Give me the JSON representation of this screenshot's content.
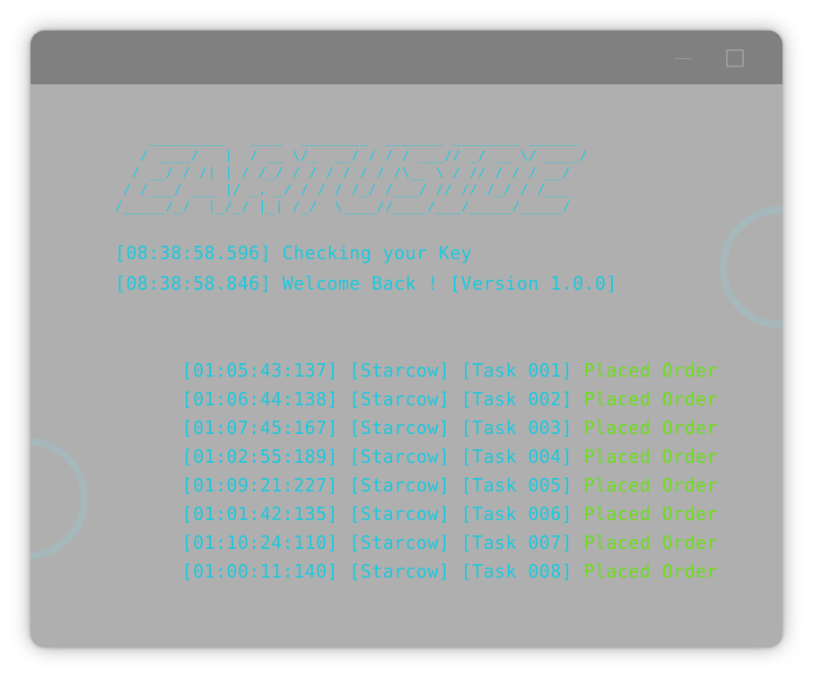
{
  "window": {
    "controls": {
      "minimize_icon": "minimize-icon",
      "maximize_icon": "maximize-icon"
    }
  },
  "colors": {
    "console_text": "#1ec8dc",
    "success_text": "#6edc1e",
    "window_bg": "#afafaf",
    "titlebar_bg": "#808080"
  },
  "console": {
    "logo": "    _________   ____  ________  _______ ________ ______\n   / ____/   |  / __ \\/_  __/ / / / ___// _/ __ \\/ ____/\n  / __/ / /| | / /_/ / / / / / / /\\__ \\ / // / / / __/\n / /___/ ___ |/ _, _/ / / / /_/ /___/ // // /_/ / /___\n/_____/_/  |_/_/ |_| /_/  \\____//____/___/_____/_____/",
    "startup": [
      "[08:38:58.596] Checking your Key",
      "[08:38:58.846] Welcome Back ! [Version 1.0.0]"
    ],
    "tasks": [
      {
        "prefix": "[01:05:43:137] [Starcow] [Task 001] ",
        "status": "Placed Order"
      },
      {
        "prefix": "[01:06:44:138] [Starcow] [Task 002] ",
        "status": "Placed Order"
      },
      {
        "prefix": "[01:07:45:167] [Starcow] [Task 003] ",
        "status": "Placed Order"
      },
      {
        "prefix": "[01:02:55:189] [Starcow] [Task 004] ",
        "status": "Placed Order"
      },
      {
        "prefix": "[01:09:21:227] [Starcow] [Task 005] ",
        "status": "Placed Order"
      },
      {
        "prefix": "[01:01:42:135] [Starcow] [Task 006] ",
        "status": "Placed Order"
      },
      {
        "prefix": "[01:10:24:110] [Starcow] [Task 007] ",
        "status": "Placed Order"
      },
      {
        "prefix": "[01:00:11:140] [Starcow] [Task 008] ",
        "status": "Placed Order"
      }
    ]
  }
}
